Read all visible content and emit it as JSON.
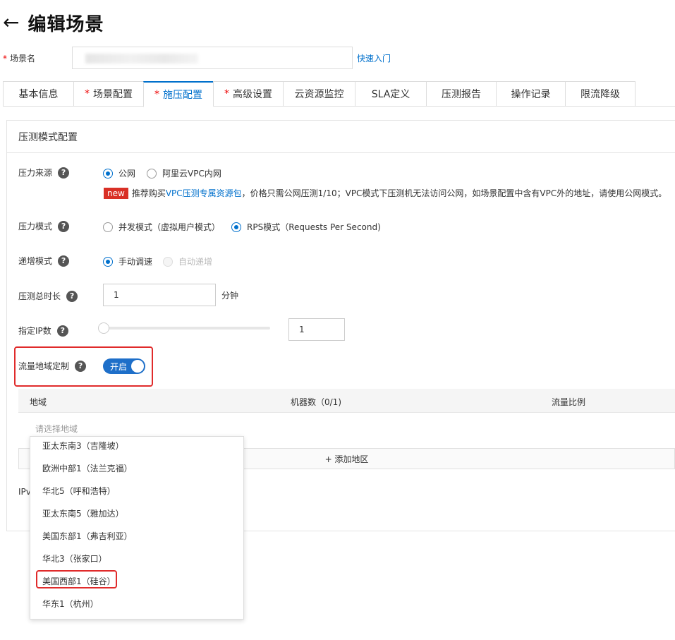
{
  "header": {
    "title": "编辑场景",
    "back_icon": "arrow-left-icon"
  },
  "scene_name": {
    "label": "场景名",
    "value": "",
    "quick_link": "快速入门"
  },
  "tabs": [
    {
      "label": "基本信息",
      "required": false,
      "active": false
    },
    {
      "label": "场景配置",
      "required": true,
      "active": false
    },
    {
      "label": "施压配置",
      "required": true,
      "active": true
    },
    {
      "label": "高级设置",
      "required": true,
      "active": false
    },
    {
      "label": "云资源监控",
      "required": false,
      "active": false
    },
    {
      "label": "SLA定义",
      "required": false,
      "active": false
    },
    {
      "label": "压测报告",
      "required": false,
      "active": false
    },
    {
      "label": "操作记录",
      "required": false,
      "active": false
    },
    {
      "label": "限流降级",
      "required": false,
      "active": false
    }
  ],
  "panel": {
    "title": "压测模式配置"
  },
  "pressure_source": {
    "label": "压力来源",
    "options": [
      "公网",
      "阿里云VPC内网"
    ],
    "selected": "公网",
    "notice": {
      "badge": "new",
      "prefix": "推荐购买",
      "link": "VPC压测专属资源包",
      "suffix": "，价格只需公网压测1/10；VPC模式下压测机无法访问公网，如场景配置中含有VPC外的地址，请使用公网模式。"
    }
  },
  "pressure_mode": {
    "label": "压力模式",
    "options": [
      "并发模式（虚拟用户模式）",
      "RPS模式（Requests Per Second)"
    ],
    "selected": "RPS模式（Requests Per Second)"
  },
  "ramp_mode": {
    "label": "递增模式",
    "options": [
      "手动调速",
      "自动递增"
    ],
    "selected": "手动调速"
  },
  "duration": {
    "label": "压测总时长",
    "value": "1",
    "unit": "分钟"
  },
  "ip_count": {
    "label": "指定IP数",
    "value": "1",
    "slider_fraction": 0
  },
  "traffic_region": {
    "label": "流量地域定制",
    "toggle_label": "开启",
    "enabled": true
  },
  "region_table": {
    "columns": [
      "地域",
      "机器数（0/1)",
      "流量比例"
    ],
    "select_placeholder": "请选择地域",
    "add_label": "+ 添加地区"
  },
  "ipv_label": "IPv",
  "region_dropdown": [
    "亚太东南3（吉隆坡）",
    "欧洲中部1（法兰克福）",
    "华北5（呼和浩特）",
    "亚太东南5（雅加达）",
    "美国东部1（弗吉利亚）",
    "华北3（张家口）",
    "美国西部1（硅谷）",
    "华东1（杭州）"
  ],
  "colors": {
    "accent": "#0070cc",
    "toggle": "#1e6fc9",
    "highlight": "#e02b2b",
    "badge": "#d93026"
  }
}
